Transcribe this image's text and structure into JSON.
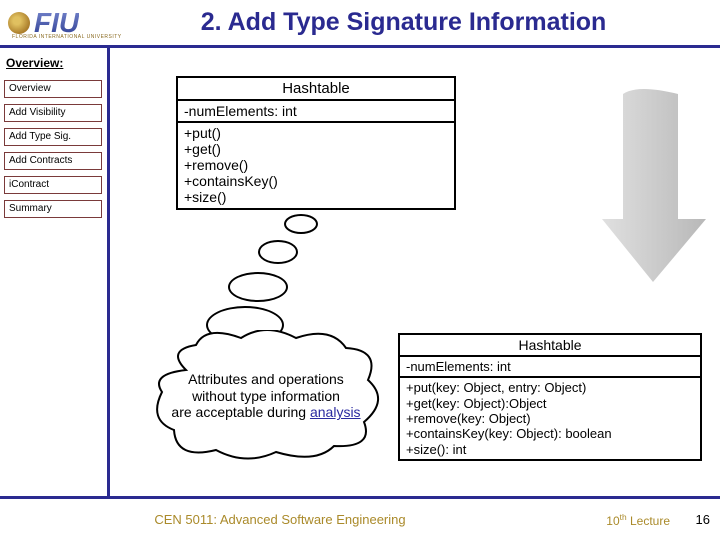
{
  "header": {
    "logo_letters": "FIU",
    "logo_sub": "FLORIDA INTERNATIONAL UNIVERSITY",
    "title": "2. Add Type Signature Information"
  },
  "sidebar": {
    "heading": "Overview:",
    "items": [
      {
        "label": "Overview"
      },
      {
        "label": "Add Visibility"
      },
      {
        "label": "Add Type Sig."
      },
      {
        "label": "Add Contracts"
      },
      {
        "label": "iContract"
      },
      {
        "label": "Summary"
      }
    ]
  },
  "uml1": {
    "name": "Hashtable",
    "attr": "-numElements: int",
    "ops": "+put()\n+get()\n+remove()\n+containsKey()\n+size()"
  },
  "uml2": {
    "name": "Hashtable",
    "attr": "-numElements: int",
    "ops": "+put(key: Object, entry: Object)\n+get(key: Object):Object\n+remove(key: Object)\n+containsKey(key: Object): boolean\n+size(): int"
  },
  "cloud": {
    "line1": "Attributes and operations",
    "line2": "without  type information",
    "line3_a": "are acceptable during ",
    "line3_b": "analysis"
  },
  "footer": {
    "source": "CEN 5011: Advanced Software Engineering",
    "lecture_pre": "10",
    "lecture_suf": "th",
    "lecture_word": " Lecture",
    "page": "16"
  }
}
